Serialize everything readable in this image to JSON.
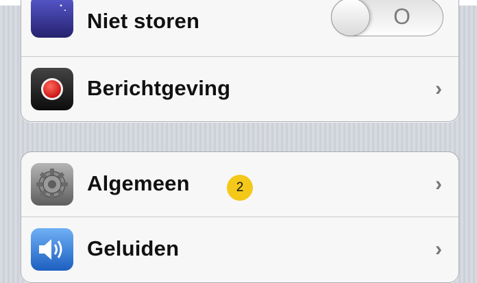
{
  "settings": {
    "group1": [
      {
        "label": "Niet storen",
        "icon": "moon-icon",
        "control": "toggle",
        "toggle_state": "O"
      },
      {
        "label": "Berichtgeving",
        "icon": "notifications-icon",
        "control": "chevron",
        "chevron": "›"
      }
    ],
    "group2": [
      {
        "label": "Algemeen",
        "icon": "gear-icon",
        "control": "chevron",
        "chevron": "›",
        "badge": "2"
      },
      {
        "label": "Geluiden",
        "icon": "speaker-icon",
        "control": "chevron",
        "chevron": "›"
      }
    ]
  },
  "colors": {
    "background": "#d3d7de",
    "badge": "#f3c819",
    "moon_icon_bg": "#3b3a9d",
    "notification_dot": "#e01818",
    "speaker_icon_bg": "#2e78d4"
  }
}
